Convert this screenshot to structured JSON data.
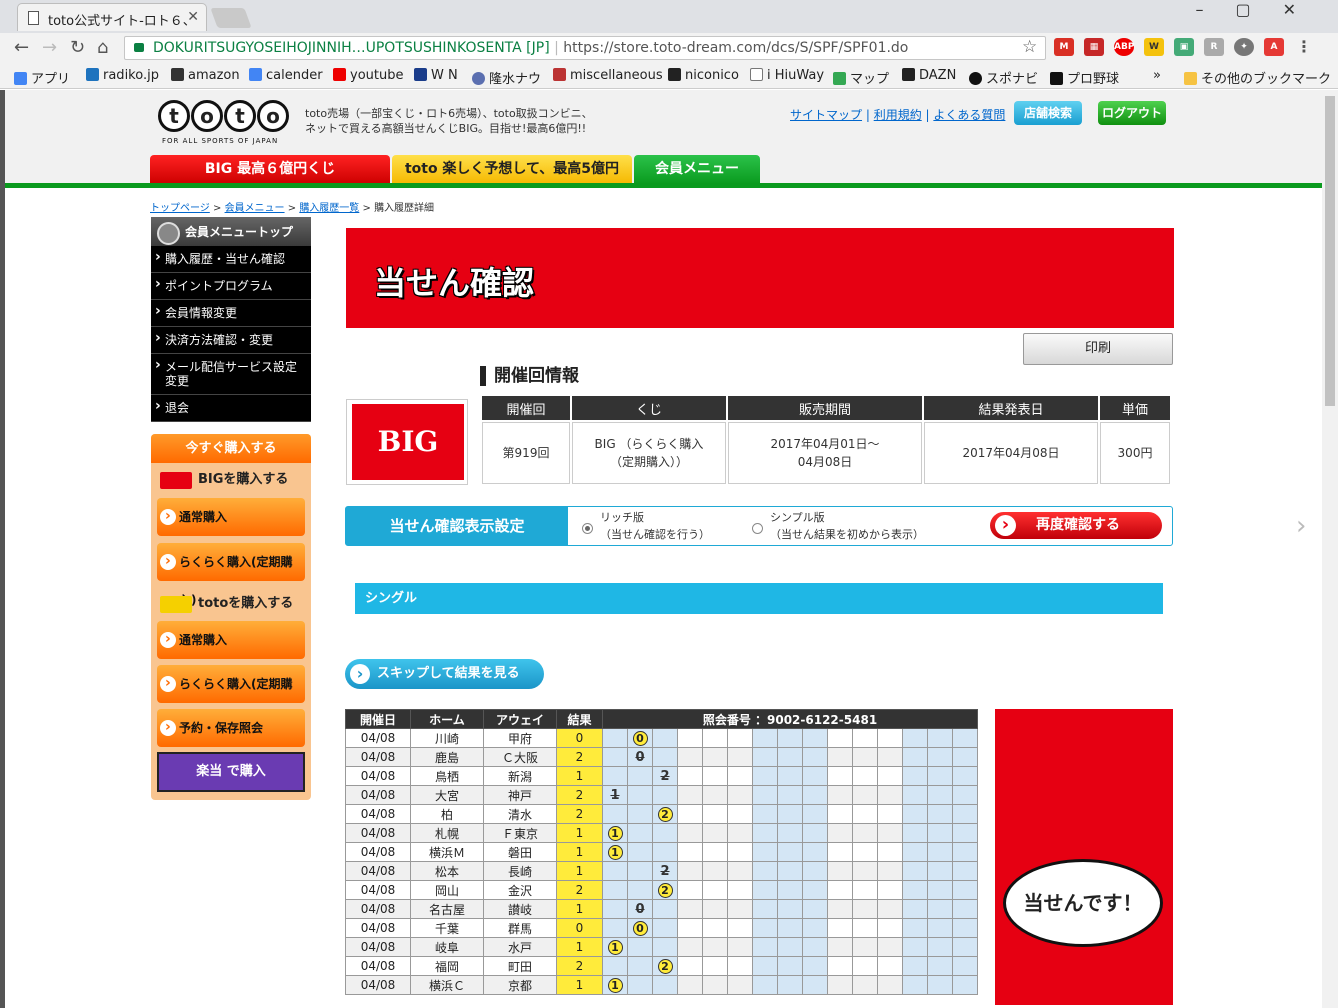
{
  "browser": {
    "tab_title": "toto公式サイト-ロト６、",
    "url_org": "DOKURITSUGYOSEIHOJINNIH…UPOTSUSHINKOSENTA [JP]",
    "url": "https://store.toto-dream.com/dcs/S/SPF/SPF01.do",
    "bookmarks": [
      "アプリ",
      "radiko.jp",
      "amazon",
      "calender",
      "youtube",
      "W N",
      "隆水ナウ",
      "miscellaneous",
      "niconico",
      "i HiuWay",
      "マップ",
      "DAZN",
      "スポナビ",
      "プロ野球",
      "»",
      "その他のブックマーク"
    ]
  },
  "header": {
    "description": "toto売場（一部宝くじ・ロト6売場）、toto取扱コンビニ、ネットで買える高額当せんくじBIG。目指せ!最高6億円!!",
    "logo_text": "toto",
    "logo_sub": "FOR ALL SPORTS OF JAPAN",
    "links": [
      "サイトマップ",
      "利用規約",
      "よくある質問"
    ],
    "store_search": "店舗検索",
    "logout": "ログアウト",
    "nav_tabs": [
      "BIG 最高６億円くじ",
      "toto 楽しく予想して、最高5億円",
      "会員メニュー"
    ]
  },
  "breadcrumb": [
    "トップページ",
    "会員メニュー",
    "購入履歴一覧",
    "購入履歴詳細"
  ],
  "sidemenu": {
    "title": "会員メニュートップ",
    "items": [
      "購入履歴・当せん確認",
      "ポイントプログラム",
      "会員情報変更",
      "決済方法確認・変更",
      "メール配信サービス設定変更",
      "退会"
    ]
  },
  "buybox": {
    "title": "今すぐ購入する",
    "big_label": "BIGを購入する",
    "toto_label": "totoを購入する",
    "normal": "通常購入",
    "rakuraku": "らくらく購入(定期購入)",
    "reserve": "予約・保存照会",
    "rakutou": "楽当 で購入"
  },
  "main": {
    "banner": "当せん確認",
    "print": "印刷",
    "section_title": "開催回情報",
    "big_logo": "BIG",
    "info_headers": [
      "開催回",
      "くじ",
      "販売期間",
      "結果発表日",
      "単価"
    ],
    "info_values": [
      "第919回",
      "BIG （らくらく購入（定期購入））",
      "2017年04月01日～04月08日",
      "2017年04月08日",
      "300円"
    ],
    "setting_label": "当せん確認表示設定",
    "rich_line1": "リッチ版",
    "rich_line2": "（当せん確認を行う）",
    "simple_line1": "シンプル版",
    "simple_line2": "（当せん結果を初めから表示）",
    "recheck": "再度確認する",
    "single_label": "シングル",
    "skip": "スキップして結果を見る",
    "win_message": "当せんです！"
  },
  "results": {
    "headers": [
      "開催日",
      "ホーム",
      "アウェイ",
      "結果"
    ],
    "ticket_label": "照会番号 ：9002-6122-5481",
    "rows": [
      {
        "date": "04/08",
        "home": "川崎",
        "away": "甲府",
        "result": "0",
        "mark": "⓪",
        "col": 1,
        "hit": true
      },
      {
        "date": "04/08",
        "home": "鹿島",
        "away": "Ｃ大阪",
        "result": "2",
        "mark": "0",
        "col": 1,
        "hit": false
      },
      {
        "date": "04/08",
        "home": "鳥栖",
        "away": "新潟",
        "result": "1",
        "mark": "2",
        "col": 2,
        "hit": false
      },
      {
        "date": "04/08",
        "home": "大宮",
        "away": "神戸",
        "result": "2",
        "mark": "1",
        "col": 0,
        "hit": false
      },
      {
        "date": "04/08",
        "home": "柏",
        "away": "清水",
        "result": "2",
        "mark": "②",
        "col": 2,
        "hit": true
      },
      {
        "date": "04/08",
        "home": "札幌",
        "away": "Ｆ東京",
        "result": "1",
        "mark": "①",
        "col": 0,
        "hit": true
      },
      {
        "date": "04/08",
        "home": "横浜Ｍ",
        "away": "磐田",
        "result": "1",
        "mark": "①",
        "col": 0,
        "hit": true
      },
      {
        "date": "04/08",
        "home": "松本",
        "away": "長崎",
        "result": "1",
        "mark": "2",
        "col": 2,
        "hit": false
      },
      {
        "date": "04/08",
        "home": "岡山",
        "away": "金沢",
        "result": "2",
        "mark": "②",
        "col": 2,
        "hit": true
      },
      {
        "date": "04/08",
        "home": "名古屋",
        "away": "讃岐",
        "result": "1",
        "mark": "0",
        "col": 1,
        "hit": false
      },
      {
        "date": "04/08",
        "home": "千葉",
        "away": "群馬",
        "result": "0",
        "mark": "⓪",
        "col": 1,
        "hit": true
      },
      {
        "date": "04/08",
        "home": "岐阜",
        "away": "水戸",
        "result": "1",
        "mark": "①",
        "col": 0,
        "hit": true
      },
      {
        "date": "04/08",
        "home": "福岡",
        "away": "町田",
        "result": "2",
        "mark": "②",
        "col": 2,
        "hit": true
      },
      {
        "date": "04/08",
        "home": "横浜Ｃ",
        "away": "京都",
        "result": "1",
        "mark": "①",
        "col": 0,
        "hit": true
      }
    ]
  },
  "colors": {
    "red": "#e60012",
    "green": "#0a9a1e",
    "blue": "#1fa9d6",
    "orange": "#ff6a00"
  }
}
